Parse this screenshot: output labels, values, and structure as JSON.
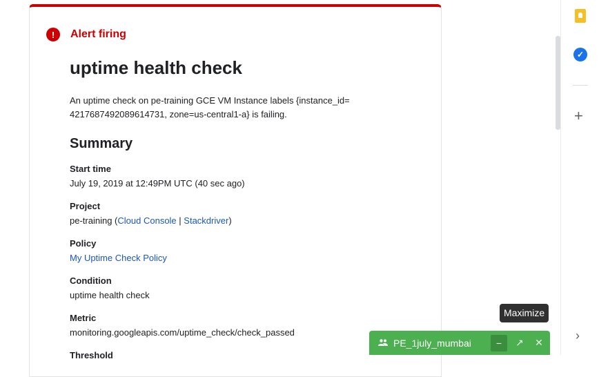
{
  "alert": {
    "icon": "!",
    "label": "Alert firing"
  },
  "title": "uptime health check",
  "description": {
    "line1": "An uptime check on pe-training GCE VM Instance labels {instance_id=",
    "line2": "4217687492089614731, zone=us-central1-a} is failing."
  },
  "summary_heading": "Summary",
  "fields": {
    "start_time": {
      "label": "Start time",
      "value": "July 19, 2019 at 12:49PM UTC (40 sec ago)"
    },
    "project": {
      "label": "Project",
      "value": "pe-training",
      "open": " (",
      "link1": "Cloud Console",
      "sep": " | ",
      "link2": "Stackdriver",
      "close": ")"
    },
    "policy": {
      "label": "Policy",
      "value": "My Uptime Check Policy"
    },
    "condition": {
      "label": "Condition",
      "value": "uptime health check"
    },
    "metric": {
      "label": "Metric",
      "value": "monitoring.googleapis.com/uptime_check/check_passed"
    },
    "threshold": {
      "label": "Threshold"
    }
  },
  "tooltip": "Maximize",
  "chat": {
    "name": "PE_1july_mumbai",
    "minimize": "−",
    "maximize": "↗",
    "close": "✕"
  },
  "rail": {
    "plus": "+",
    "chevron": "›"
  },
  "colors": {
    "alert_red": "#cc0000",
    "link_blue": "#1a56c6",
    "chat_green": "#4caf50"
  }
}
